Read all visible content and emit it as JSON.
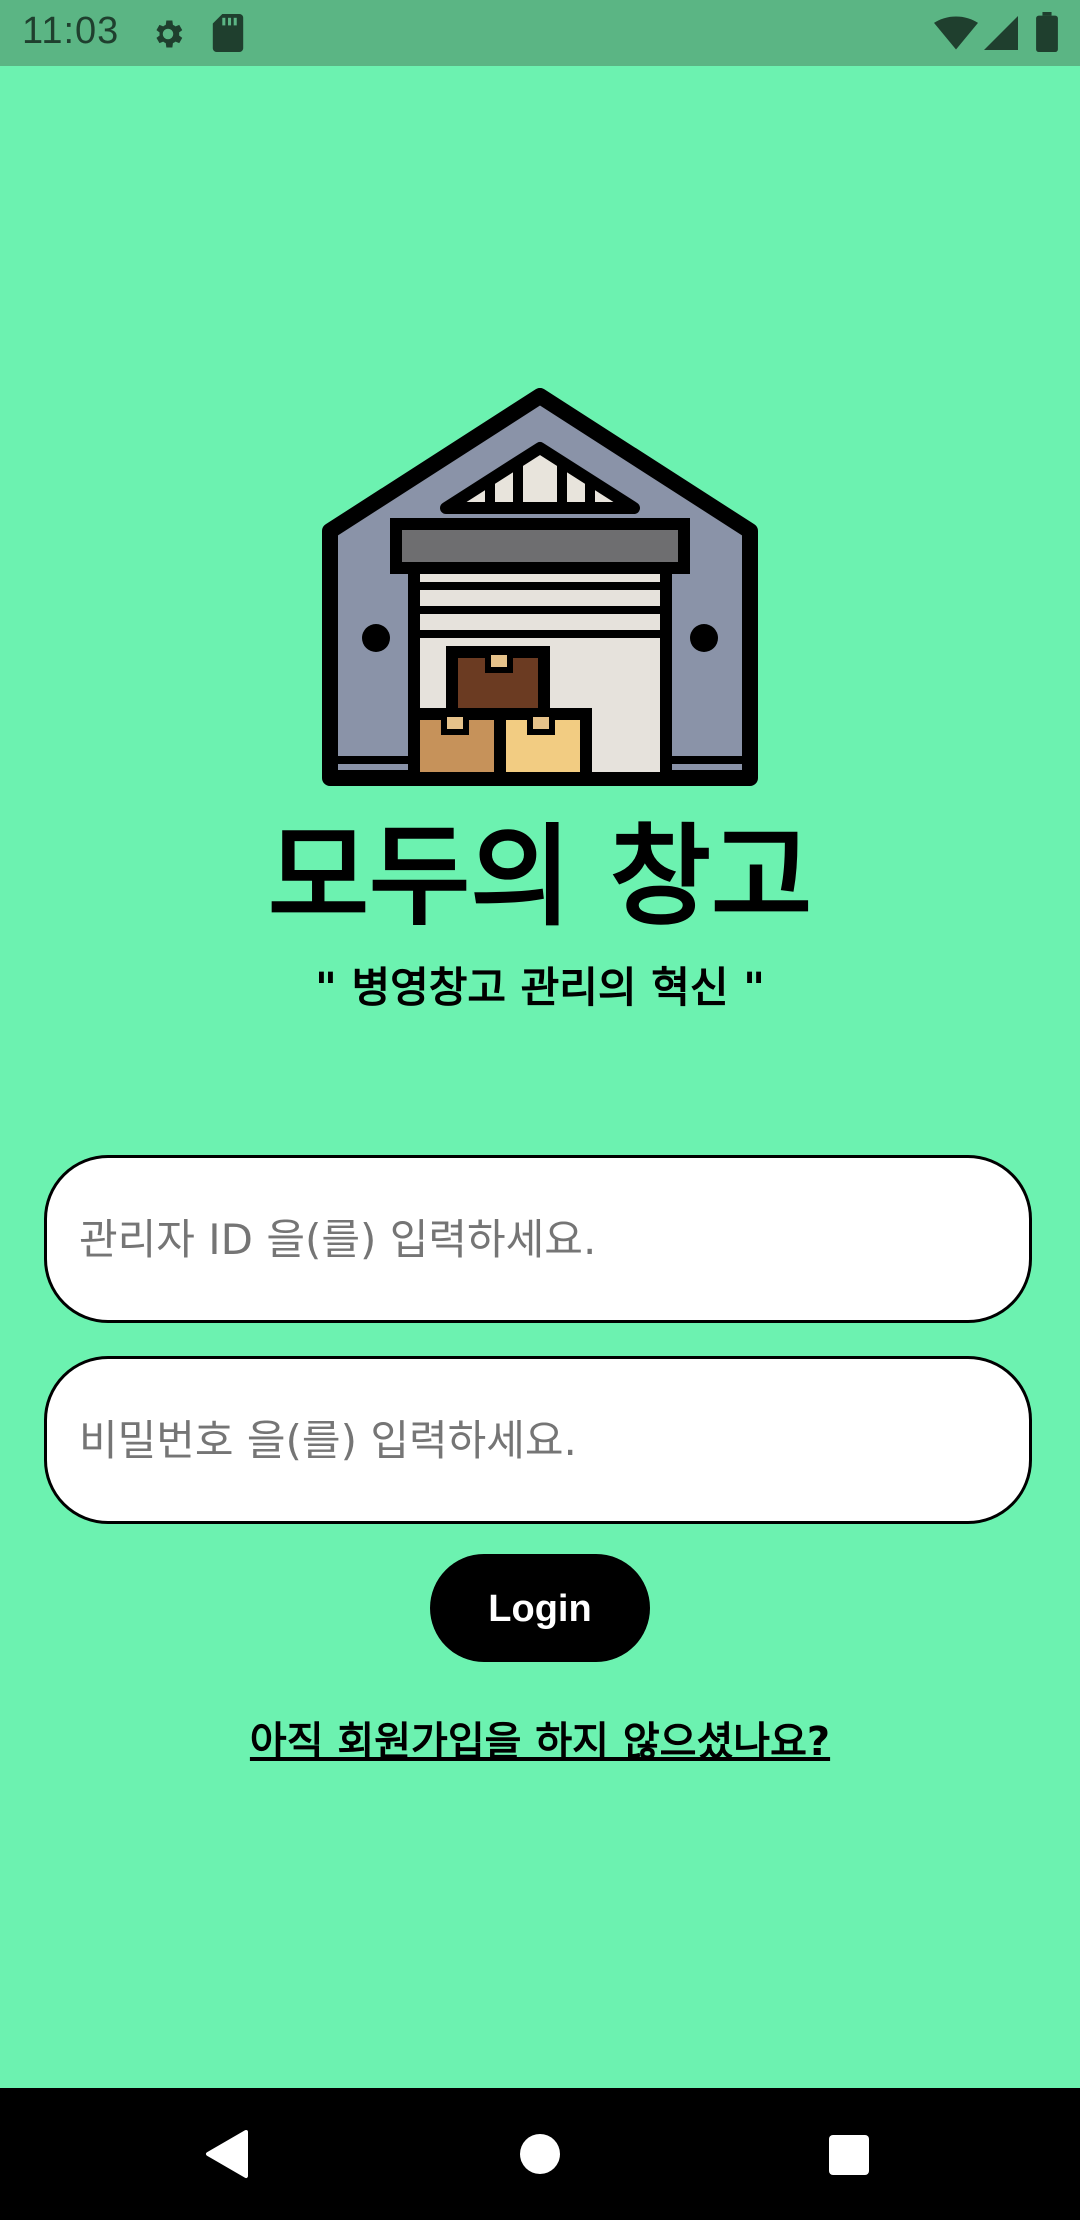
{
  "status_bar": {
    "time": "11:03",
    "icons": [
      "gear-icon",
      "sd-card-icon",
      "wifi-icon",
      "signal-icon",
      "battery-icon"
    ]
  },
  "app": {
    "title": "모두의 창고",
    "subtitle": "\" 병영창고 관리의 혁신 \"",
    "logo": "warehouse-icon"
  },
  "login_form": {
    "id_placeholder": "관리자 ID 을(를) 입력하세요.",
    "password_placeholder": "비밀번호 을(를) 입력하세요.",
    "login_label": "Login",
    "signup_link": "아직 회원가입을 하지 않으셨나요?"
  },
  "navigation_bar": {
    "buttons": [
      "back-icon",
      "home-icon",
      "recents-icon"
    ]
  },
  "colors": {
    "background": "#6cf2b0",
    "status_bar": "#5bb584",
    "button": "#000000",
    "nav_bar": "#000000"
  }
}
